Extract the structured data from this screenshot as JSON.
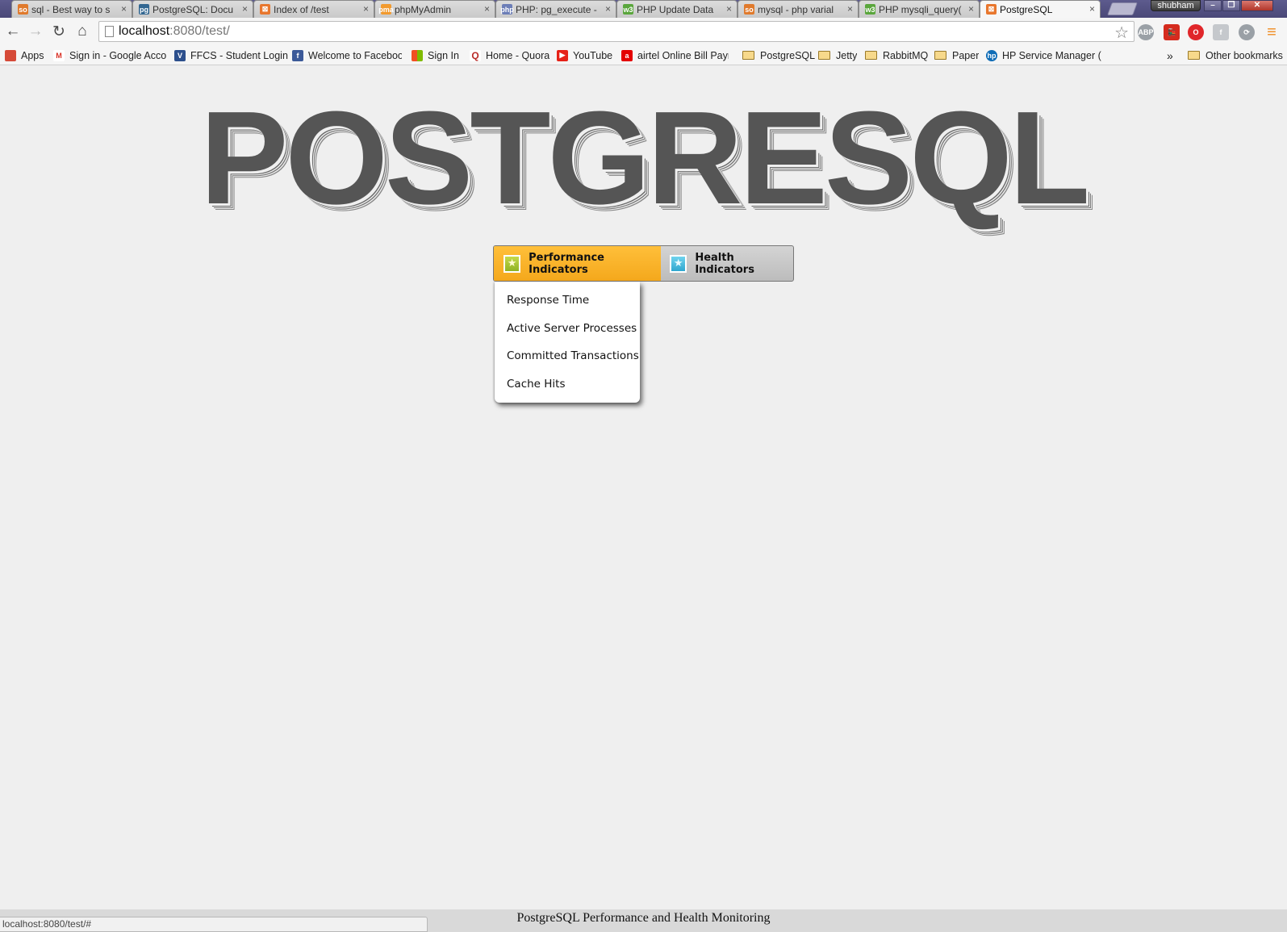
{
  "browser": {
    "tabs": [
      {
        "title": "sql - Best way to s",
        "close": "×",
        "favicon": "so",
        "color": "#e07a2c"
      },
      {
        "title": "PostgreSQL: Docu",
        "close": "×",
        "favicon": "pg",
        "color": "#336791"
      },
      {
        "title": "Index of /test",
        "close": "×",
        "favicon": "⊠",
        "color": "#e8772e"
      },
      {
        "title": "phpMyAdmin",
        "close": "×",
        "favicon": "pma",
        "color": "#f29a2e"
      },
      {
        "title": "PHP: pg_execute -",
        "close": "×",
        "favicon": "php",
        "color": "#6c7eb7"
      },
      {
        "title": "PHP Update Data",
        "close": "×",
        "favicon": "w3",
        "color": "#5aa63c"
      },
      {
        "title": "mysql - php varial",
        "close": "×",
        "favicon": "so",
        "color": "#e07a2c"
      },
      {
        "title": "PHP mysqli_query(",
        "close": "×",
        "favicon": "w3",
        "color": "#5aa63c"
      },
      {
        "title": "PostgreSQL",
        "close": "×",
        "favicon": "⊠",
        "color": "#e8772e"
      }
    ],
    "profile": "shubham",
    "window_controls": {
      "minimize": "–",
      "restore": "❐",
      "close": "✕"
    },
    "nav": {
      "back": "←",
      "forward": "→",
      "reload": "↻",
      "home": "⌂"
    },
    "address": {
      "host": "localhost",
      "path": ":8080/test/"
    },
    "star": "☆",
    "extensions": [
      {
        "name": "adblock-plus-icon",
        "label": "ABP",
        "color": "#9aa0a6"
      },
      {
        "name": "train-icon",
        "label": "🚂",
        "color": "#d52b1e"
      },
      {
        "name": "opera-icon",
        "label": "O",
        "color": "#e0262a"
      },
      {
        "name": "facebook-icon",
        "label": "f",
        "color": "#c5c8cc"
      },
      {
        "name": "sync-icon",
        "label": "⟳",
        "color": "#9aa0a6"
      },
      {
        "name": "menu-icon",
        "label": "≡",
        "color": "#f08b1f"
      }
    ],
    "bookmarks": [
      {
        "label": "Apps",
        "icon": "apps",
        "color": "#d64a38"
      },
      {
        "label": "Sign in - Google Acco",
        "icon": "M",
        "color": "#d93025"
      },
      {
        "label": "FFCS - Student Login",
        "icon": "V",
        "color": "#2c4f8c"
      },
      {
        "label": "Welcome to Faceboo",
        "icon": "f",
        "color": "#3b5998"
      },
      {
        "label": "Sign In",
        "icon": "ms",
        "color": "#f25022"
      },
      {
        "label": "Home - Quora",
        "icon": "Q",
        "color": "#b92b27"
      },
      {
        "label": "YouTube",
        "icon": "▶",
        "color": "#e62117"
      },
      {
        "label": "airtel Online Bill Paym",
        "icon": "a",
        "color": "#e40000"
      },
      {
        "label": "PostgreSQL",
        "icon": "folder",
        "color": "#f7d98b"
      },
      {
        "label": "Jetty",
        "icon": "folder",
        "color": "#f7d98b"
      },
      {
        "label": "RabbitMQ",
        "icon": "folder",
        "color": "#f7d98b"
      },
      {
        "label": "Paper",
        "icon": "folder",
        "color": "#f7d98b"
      },
      {
        "label": "HP Service Manager (",
        "icon": "hp",
        "color": "#0f6cb6"
      }
    ],
    "bookmarks_overflow": "»",
    "other_bookmarks": "Other bookmarks",
    "status_url": "localhost:8080/test/#"
  },
  "page": {
    "title": "POSTGRESQL",
    "menu": {
      "performance_label": "Performance Indicators",
      "health_label": "Health Indicators",
      "icon_glyph": "★",
      "active_color": "#f4a81c"
    },
    "dropdown": [
      "Response Time",
      "Active Server Processes",
      "Committed Transactions",
      "Cache Hits"
    ],
    "footer": "PostgreSQL Performance and Health Monitoring"
  }
}
